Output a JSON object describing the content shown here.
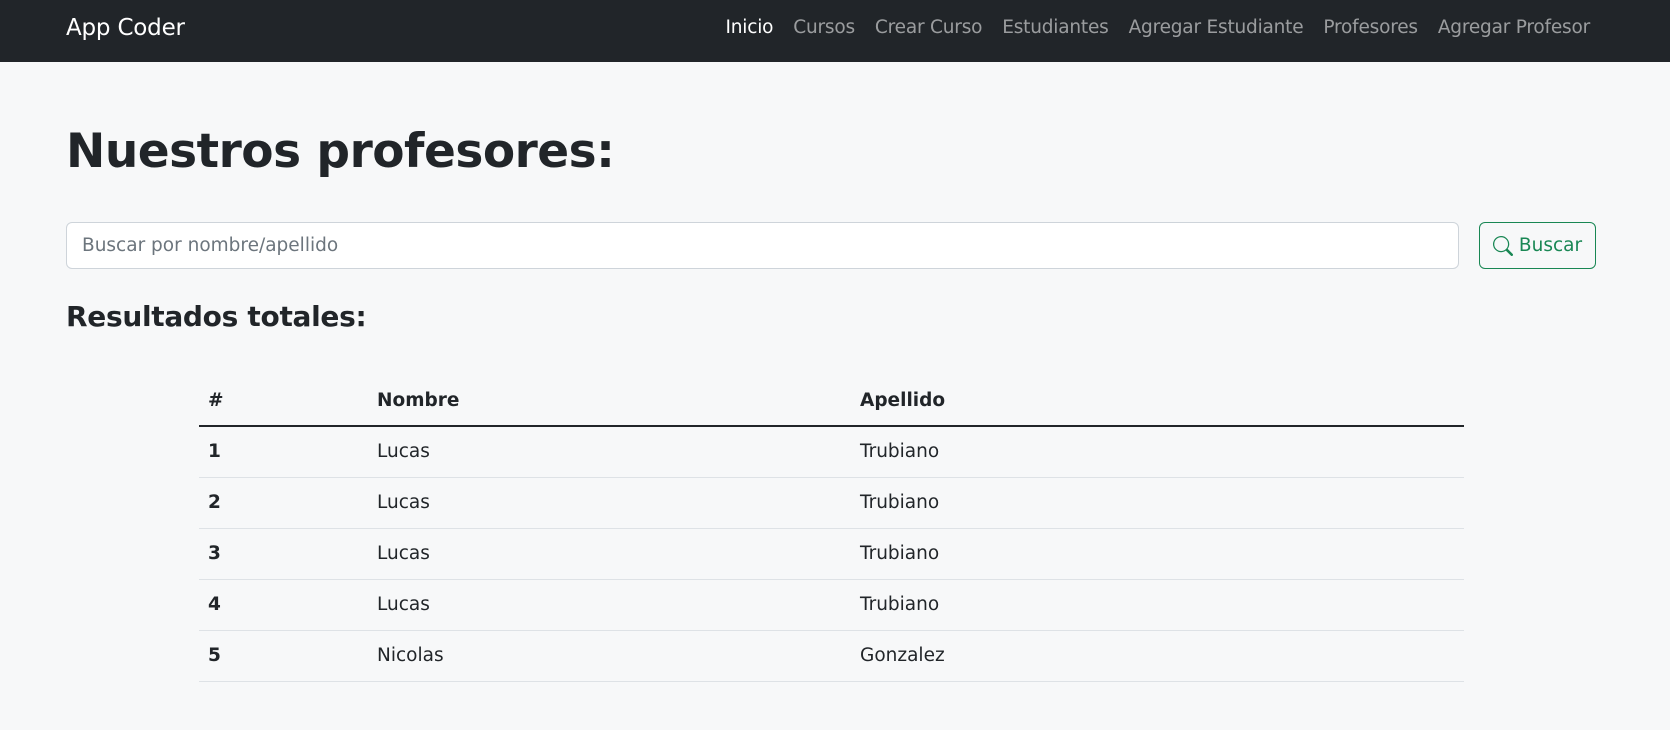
{
  "navbar": {
    "brand": "App Coder",
    "links": [
      {
        "label": "Inicio",
        "active": true
      },
      {
        "label": "Cursos",
        "active": false
      },
      {
        "label": "Crear Curso",
        "active": false
      },
      {
        "label": "Estudiantes",
        "active": false
      },
      {
        "label": "Agregar Estudiante",
        "active": false
      },
      {
        "label": "Profesores",
        "active": false
      },
      {
        "label": "Agregar Profesor",
        "active": false
      }
    ]
  },
  "main": {
    "title": "Nuestros profesores:",
    "search": {
      "placeholder": "Buscar por nombre/apellido",
      "value": "",
      "button_label": "Buscar",
      "button_icon": "search-icon"
    },
    "results_title": "Resultados totales:",
    "table": {
      "headers": [
        "#",
        "Nombre",
        "Apellido"
      ],
      "rows": [
        {
          "num": "1",
          "nombre": "Lucas",
          "apellido": "Trubiano"
        },
        {
          "num": "2",
          "nombre": "Lucas",
          "apellido": "Trubiano"
        },
        {
          "num": "3",
          "nombre": "Lucas",
          "apellido": "Trubiano"
        },
        {
          "num": "4",
          "nombre": "Lucas",
          "apellido": "Trubiano"
        },
        {
          "num": "5",
          "nombre": "Nicolas",
          "apellido": "Gonzalez"
        }
      ]
    }
  },
  "colors": {
    "navbar_bg": "#212529",
    "accent_success": "#198754",
    "page_bg": "#f7f8f9"
  }
}
